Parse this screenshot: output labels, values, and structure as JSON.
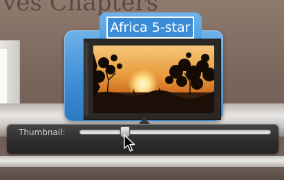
{
  "background": {
    "heading": "ves Chapters"
  },
  "popover": {
    "title": "Africa 5-star",
    "photo_icon": "sunset-photo"
  },
  "thumbnail_slider": {
    "label": "Thumbnail:",
    "value_fraction": 0.24
  },
  "cursor_icon": "arrow-cursor",
  "colors": {
    "accent": "#3f8fd6",
    "slider_bar": "#2e2e2e",
    "title_text": "#ffffff"
  }
}
